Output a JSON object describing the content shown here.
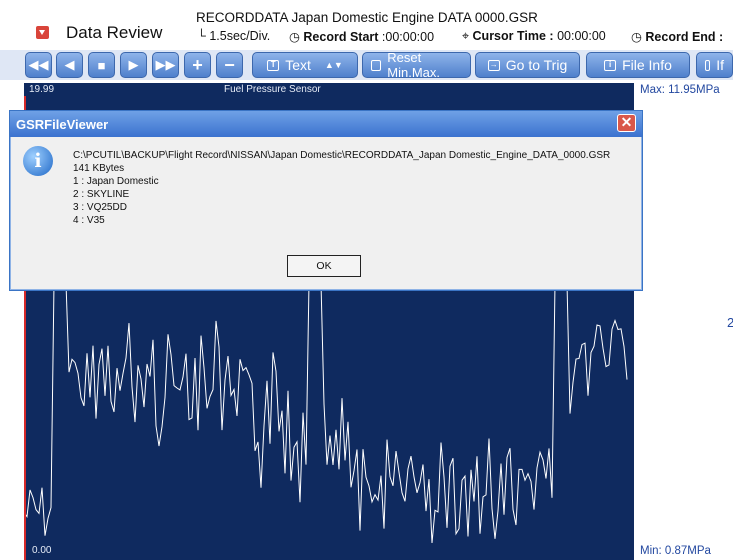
{
  "app": {
    "title": "Data Review",
    "file_title": "RECORDDATA  Japan Domestic  Engine  DATA  0000.GSR"
  },
  "info_bar": {
    "scale": "1.5sec/Div.",
    "record_start_label": "Record Start",
    "record_start_value": ":00:00:00",
    "cursor_time_label": "Cursor Time :",
    "cursor_time_value": "00:00:00",
    "record_end_label": "Record End :"
  },
  "toolbar": {
    "text_label": "Text",
    "reset_label": "Reset Min.Max.",
    "goto_label": "Go to Trig",
    "fileinfo_label": "File Info",
    "more_label": "If"
  },
  "graph": {
    "top_value": "19.99",
    "bottom_value": "0.00",
    "sensor_name": "Fuel Pressure Sensor",
    "max_label": "Max: 11.95MPa",
    "min_label": "Min:   0.87MPa",
    "axis_fragment": "2",
    "line_color": "#ffffff",
    "background_color": "#0f2a5f"
  },
  "dialog": {
    "title": "GSRFileViewer",
    "lines": [
      "C:\\PCUTIL\\BACKUP\\Flight Record\\NISSAN\\Japan Domestic\\RECORDDATA_Japan Domestic_Engine_DATA_0000.GSR",
      "141 KBytes",
      "1 : Japan Domestic",
      "2 : SKYLINE",
      "3 : VQ25DD",
      "4 : V35"
    ],
    "ok_label": "OK",
    "icon": "info-icon"
  }
}
